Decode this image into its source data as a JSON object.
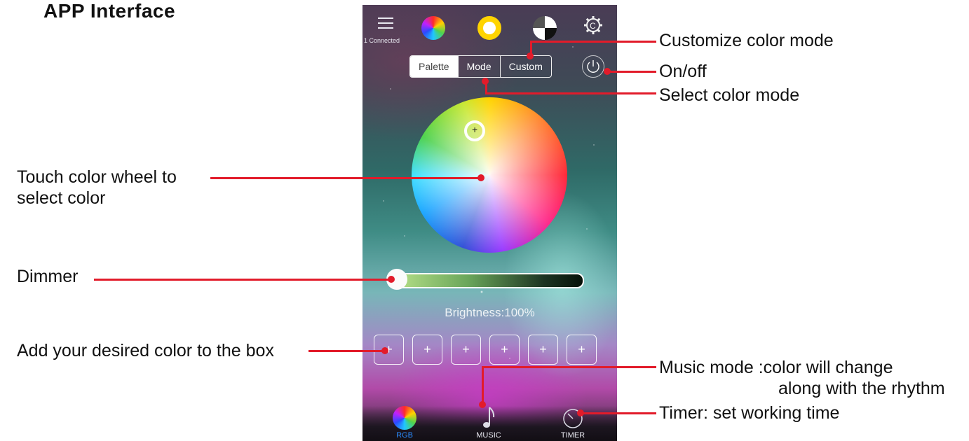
{
  "page": {
    "title": "APP Interface"
  },
  "app": {
    "header": {
      "connected": "1 Connected"
    },
    "tabs": [
      "Palette",
      "Mode",
      "Custom"
    ],
    "brightness": "Brightness:100%",
    "brightness_level_percent": 100,
    "color_boxes": [
      "+",
      "+",
      "+",
      "+",
      "+",
      "+"
    ],
    "nav": {
      "rgb": "RGB",
      "music": "MUSIC",
      "timer": "TIMER"
    },
    "icons": {
      "menu": "menu-icon",
      "color_wheel": "color-wheel-icon",
      "ring": "color-ring-icon",
      "black_white": "black-white-icon",
      "settings": "gear-icon",
      "power": "power-icon",
      "music": "music-note-icon",
      "timer": "timer-icon"
    }
  },
  "callouts": {
    "customize": "Customize color mode",
    "onoff": "On/off",
    "select_mode": "Select color mode",
    "wheel_line1": "Touch color wheel to",
    "wheel_line2": " select color",
    "dimmer": "Dimmer",
    "boxes": "Add your desired color to the box",
    "music_line1": "Music mode :color will change",
    "music_line2": "along with the rhythm",
    "timer": "Timer: set working time"
  },
  "colors": {
    "callout_line": "#e21b2a",
    "active_nav": "#2a8cff"
  }
}
